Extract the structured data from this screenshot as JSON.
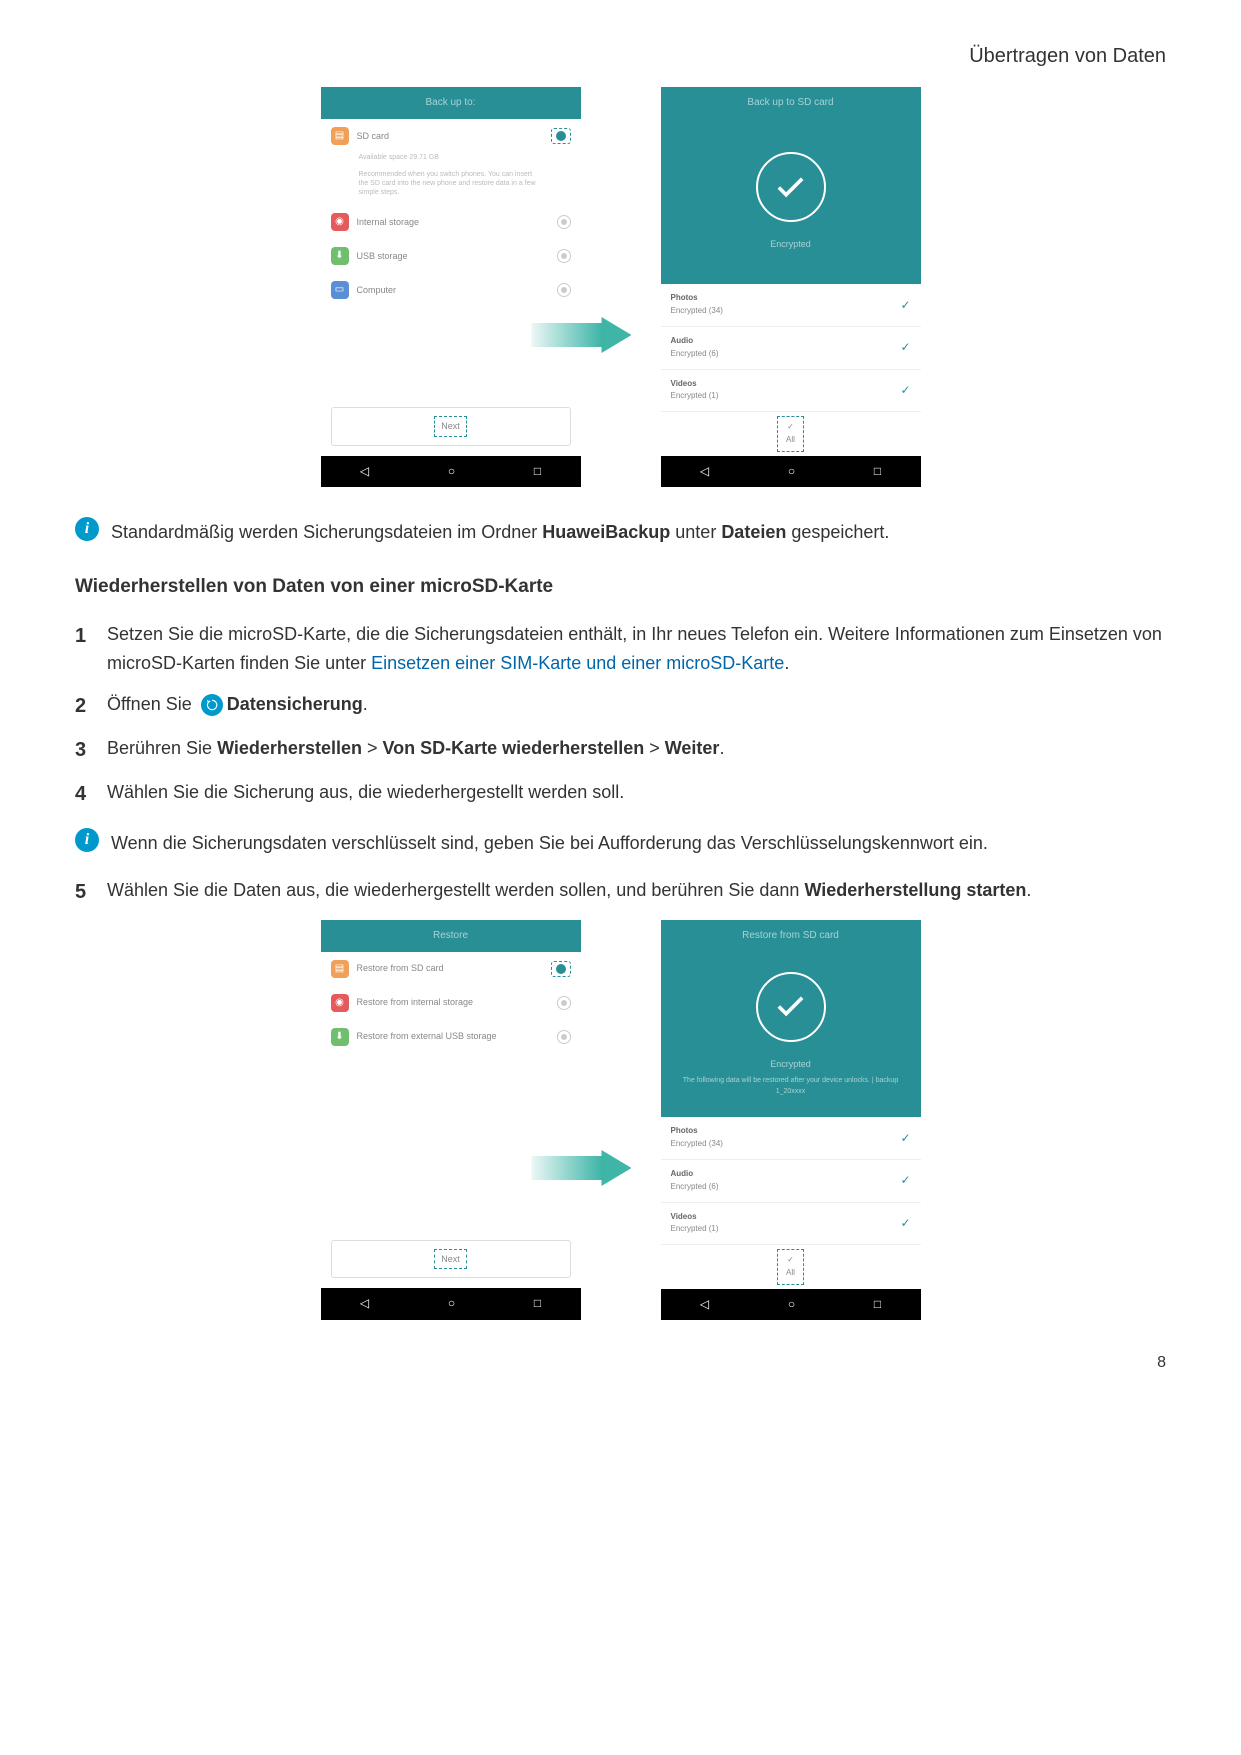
{
  "header": {
    "title": "Übertragen von Daten"
  },
  "page_number": "8",
  "screenshots_1": {
    "left": {
      "header": "Back up to:",
      "options": [
        {
          "icon": "sd",
          "label": "SD card",
          "selected": true
        },
        {
          "icon": "internal",
          "label": "Internal storage",
          "selected": false
        },
        {
          "icon": "usb",
          "label": "USB storage",
          "selected": false
        },
        {
          "icon": "computer",
          "label": "Computer",
          "selected": false
        }
      ],
      "desc1": "Available space 29.71 GB",
      "desc2": "Recommended when you switch phones. You can insert the SD card into the new phone and restore data in a few simple steps.",
      "next": "Next"
    },
    "right": {
      "header": "Back up to SD card",
      "status": "Encrypted",
      "items": [
        {
          "title": "Photos",
          "sub": "Encrypted (34)"
        },
        {
          "title": "Audio",
          "sub": "Encrypted (6)"
        },
        {
          "title": "Videos",
          "sub": "Encrypted (1)"
        }
      ],
      "select_all": "All"
    }
  },
  "info1": {
    "text_before": "Standardmäßig werden Sicherungsdateien im Ordner ",
    "bold1": "HuaweiBackup",
    "text_mid": " unter ",
    "bold2": "Dateien",
    "text_after": " gespeichert."
  },
  "section_heading": "Wiederherstellen von Daten von einer microSD-Karte",
  "steps": {
    "s1": {
      "text": "Setzen Sie die microSD-Karte, die die Sicherungsdateien enthält, in Ihr neues Telefon ein. Weitere Informationen zum Einsetzen von microSD-Karten finden Sie unter ",
      "link": "Einsetzen einer SIM-Karte und einer microSD-Karte",
      "after": "."
    },
    "s2": {
      "before": "Öffnen Sie ",
      "bold": "Datensicherung",
      "after": "."
    },
    "s3": {
      "before": "Berühren Sie ",
      "b1": "Wiederherstellen",
      "gt1": " > ",
      "b2": "Von SD-Karte wiederherstellen",
      "gt2": " > ",
      "b3": "Weiter",
      "after": "."
    },
    "s4": {
      "text": "Wählen Sie die Sicherung aus, die wiederhergestellt werden soll."
    },
    "s5": {
      "text": "Wählen Sie die Daten aus, die wiederhergestellt werden sollen, und berühren Sie dann ",
      "bold": "Wiederherstellung starten",
      "after": "."
    }
  },
  "info2": {
    "text": "Wenn die Sicherungsdaten verschlüsselt sind, geben Sie bei Aufforderung das Verschlüsselungskennwort ein."
  },
  "screenshots_2": {
    "left": {
      "header": "Restore",
      "options": [
        {
          "icon": "sd",
          "label": "Restore from SD card",
          "selected": true
        },
        {
          "icon": "internal",
          "label": "Restore from internal storage",
          "selected": false
        },
        {
          "icon": "usb",
          "label": "Restore from external USB storage",
          "selected": false
        }
      ],
      "next": "Next"
    },
    "right": {
      "header": "Restore from SD card",
      "status": "Encrypted",
      "sub": "The following data will be restored after your device unlocks. | backup 1_20xxxx",
      "items": [
        {
          "title": "Photos",
          "sub": "Encrypted (34)"
        },
        {
          "title": "Audio",
          "sub": "Encrypted (6)"
        },
        {
          "title": "Videos",
          "sub": "Encrypted (1)"
        }
      ],
      "select_all": "All"
    }
  }
}
